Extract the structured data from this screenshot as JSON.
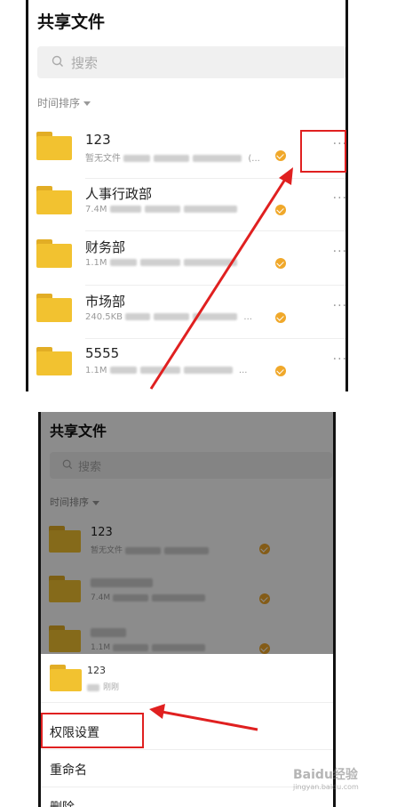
{
  "top": {
    "title": "共享文件",
    "search_placeholder": "搜索",
    "sort_label": "时间排序",
    "rows": [
      {
        "name": "123",
        "meta": "暂无文件",
        "more": "···"
      },
      {
        "name": "人事行政部",
        "meta": "7.4M",
        "more": "···"
      },
      {
        "name": "财务部",
        "meta": "1.1M",
        "more": "···"
      },
      {
        "name": "市场部",
        "meta": "240.5KB",
        "more": "···"
      },
      {
        "name": "5555",
        "meta": "1.1M",
        "more": "···"
      }
    ]
  },
  "bottom": {
    "title": "共享文件",
    "search_placeholder": "搜索",
    "sort_label": "时间排序",
    "rows": [
      {
        "name": "123",
        "meta": "暂无文件",
        "more": "···"
      },
      {
        "name": "",
        "meta": "7.4M",
        "more": "···"
      },
      {
        "name": "",
        "meta": "1.1M",
        "more": "···"
      }
    ],
    "sheet": {
      "folder_name": "123",
      "folder_sub": "刚刚",
      "items": [
        "权限设置",
        "重命名",
        "删除"
      ]
    }
  },
  "watermark": {
    "brand": "Baidu经验",
    "sub": "jingyan.baidu.com"
  },
  "colors": {
    "accent_red": "#e02020",
    "folder": "#f2c230",
    "check": "#f0a82a"
  }
}
